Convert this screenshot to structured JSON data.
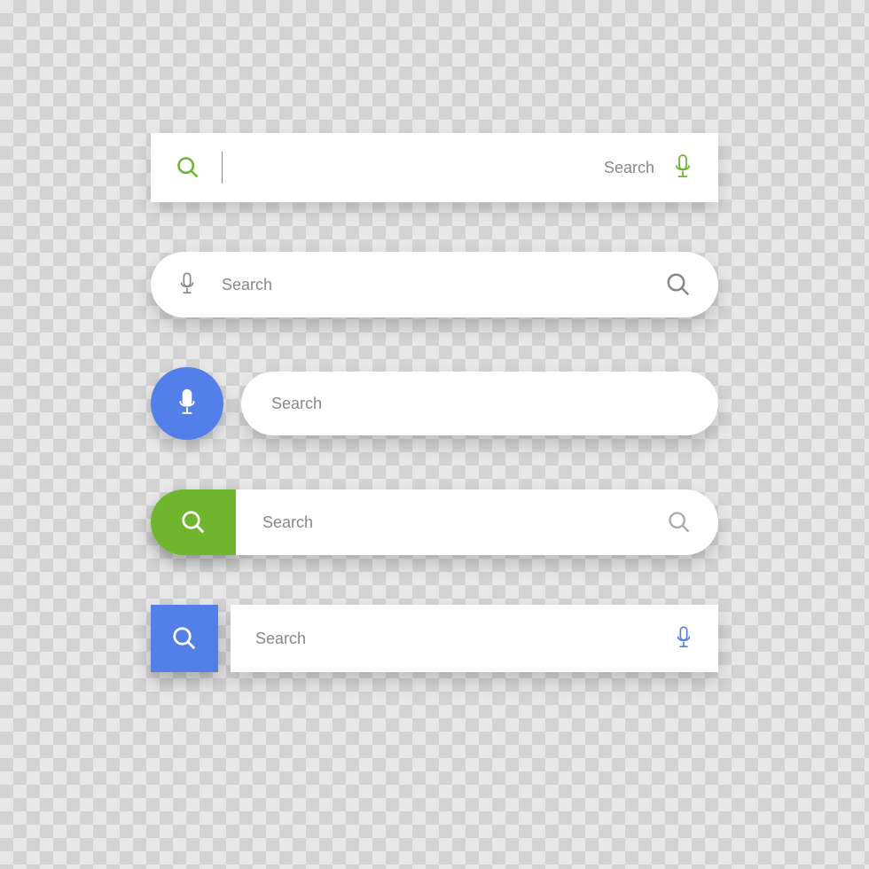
{
  "colors": {
    "green": "#6fb52e",
    "blue": "#5380e8",
    "gray": "#888888",
    "white": "#ffffff"
  },
  "searchBars": [
    {
      "label": "Search",
      "style": "rectangular",
      "leftIcon": "search",
      "rightIcon": "microphone",
      "accentColor": "green",
      "hasCursor": true
    },
    {
      "label": "Search",
      "style": "pill",
      "leftIcon": "microphone",
      "rightIcon": "search",
      "accentColor": "gray"
    },
    {
      "label": "Search",
      "style": "circle-attach-pill",
      "leftIcon": "microphone",
      "accentColor": "blue"
    },
    {
      "label": "Search",
      "style": "rounded-attach-pill",
      "leftIcon": "search",
      "rightIcon": "search",
      "accentColor": "green"
    },
    {
      "label": "Search",
      "style": "square-attach-rect",
      "leftIcon": "search",
      "rightIcon": "microphone",
      "accentColor": "blue"
    }
  ]
}
